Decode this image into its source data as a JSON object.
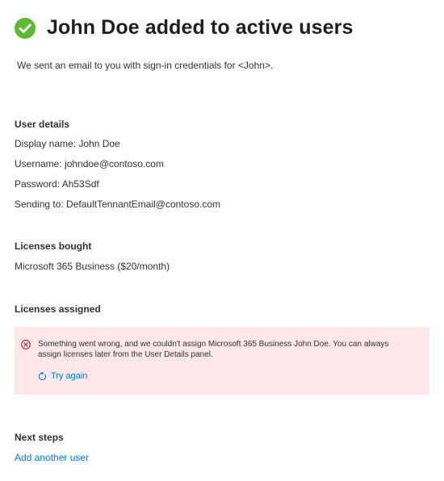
{
  "header": {
    "title": "John Doe added to active users",
    "success_color": "#5fb832"
  },
  "subtitle": "We sent an email to you with sign-in credentials for <John>.",
  "user_details": {
    "heading": "User details",
    "display_name": "Display name: John Doe",
    "username": "Username: johndoe@contoso.com",
    "password": "Password: Ah53Sdf",
    "sending_to": "Sending to: DefaultTennantEmail@contoso.com"
  },
  "licenses_bought": {
    "heading": "Licenses bought",
    "item": "Microsoft 365 Business ($20/month)"
  },
  "licenses_assigned": {
    "heading": "Licenses assigned",
    "error": {
      "icon": "error-circle-icon",
      "message": "Something went wrong, and we couldn't assign Microsoft 365 Business John Doe. You can always assign licenses later from the User Details panel.",
      "retry_label": "Try again",
      "retry_icon": "refresh-icon",
      "background_color": "#fde7e9",
      "icon_color": "#a4262c"
    }
  },
  "next_steps": {
    "heading": "Next steps",
    "add_another_user": "Add another user"
  },
  "colors": {
    "link": "#0078d4",
    "text": "#323130"
  }
}
